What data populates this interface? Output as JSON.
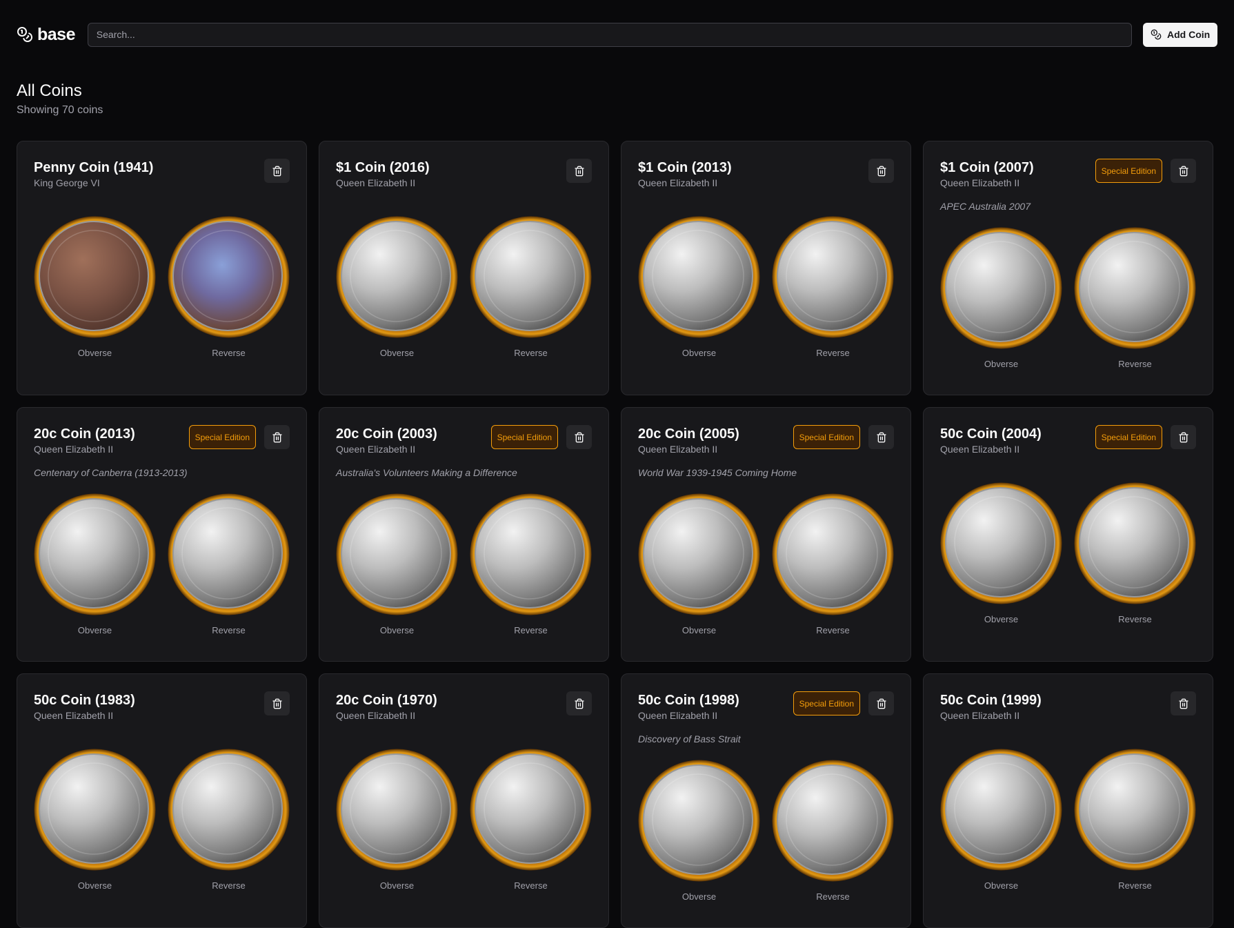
{
  "app": {
    "logo_text": "base"
  },
  "search": {
    "placeholder": "Search..."
  },
  "header": {
    "add_label": "Add Coin"
  },
  "page": {
    "title": "All Coins",
    "subtitle": "Showing 70 coins"
  },
  "labels": {
    "obverse": "Obverse",
    "reverse": "Reverse"
  },
  "colors": {
    "background": "#09090b",
    "card": "#18181b",
    "accent": "#f59e0b",
    "coin_rim": "#d98a0d"
  },
  "cards": [
    {
      "title": "Penny Coin (1941)",
      "monarch": "King George VI",
      "special": "",
      "note": "",
      "obverse": "bronze",
      "reverse": "blue-patina"
    },
    {
      "title": "$1 Coin (2016)",
      "monarch": "Queen Elizabeth II",
      "special": "",
      "note": "",
      "obverse": "silver",
      "reverse": "silver"
    },
    {
      "title": "$1 Coin (2013)",
      "monarch": "Queen Elizabeth II",
      "special": "",
      "note": "",
      "obverse": "silver",
      "reverse": "silver"
    },
    {
      "title": "$1 Coin (2007)",
      "monarch": "Queen Elizabeth II",
      "special": "Special Edition",
      "note": "APEC Australia 2007",
      "obverse": "silver",
      "reverse": "silver"
    },
    {
      "title": "20c Coin (2013)",
      "monarch": "Queen Elizabeth II",
      "special": "Special Edition",
      "note": "Centenary of Canberra (1913-2013)",
      "obverse": "silver",
      "reverse": "silver"
    },
    {
      "title": "20c Coin (2003)",
      "monarch": "Queen Elizabeth II",
      "special": "Special Edition",
      "note": "Australia's Volunteers Making a Difference",
      "obverse": "silver",
      "reverse": "silver"
    },
    {
      "title": "20c Coin (2005)",
      "monarch": "Queen Elizabeth II",
      "special": "Special Edition",
      "note": "World War 1939-1945 Coming Home",
      "obverse": "silver",
      "reverse": "silver"
    },
    {
      "title": "50c Coin (2004)",
      "monarch": "Queen Elizabeth II",
      "special": "Special Edition",
      "note": "",
      "obverse": "silver",
      "reverse": "silver"
    },
    {
      "title": "50c Coin (1983)",
      "monarch": "Queen Elizabeth II",
      "special": "",
      "note": "",
      "obverse": "silver",
      "reverse": "silver"
    },
    {
      "title": "20c Coin (1970)",
      "monarch": "Queen Elizabeth II",
      "special": "",
      "note": "",
      "obverse": "silver",
      "reverse": "silver"
    },
    {
      "title": "50c Coin (1998)",
      "monarch": "Queen Elizabeth II",
      "special": "Special Edition",
      "note": "Discovery of Bass Strait",
      "obverse": "silver",
      "reverse": "silver"
    },
    {
      "title": "50c Coin (1999)",
      "monarch": "Queen Elizabeth II",
      "special": "",
      "note": "",
      "obverse": "silver",
      "reverse": "silver"
    }
  ]
}
